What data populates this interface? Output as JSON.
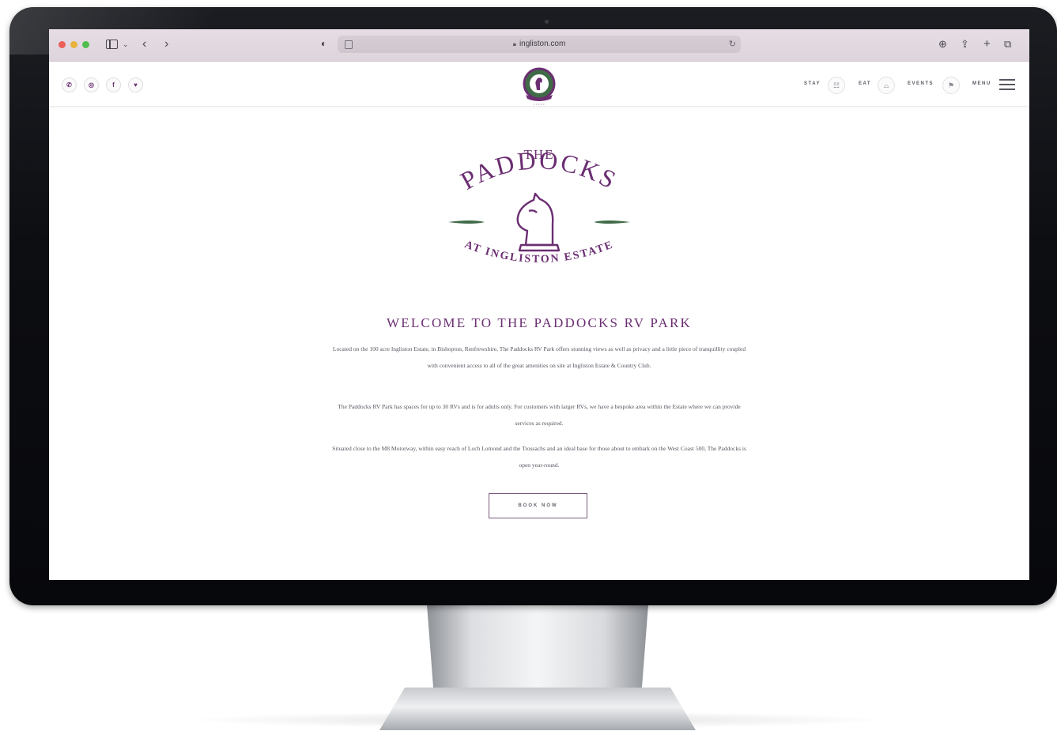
{
  "browser": {
    "url": "ingliston.com"
  },
  "header": {
    "nav": [
      {
        "label": "STAY",
        "icon": "bed-icon"
      },
      {
        "label": "EAT",
        "icon": "cloche-icon"
      },
      {
        "label": "EVENTS",
        "icon": "events-icon"
      },
      {
        "label": "MENU",
        "icon": "hamburger-icon"
      }
    ],
    "social_icons": [
      "phone-icon",
      "instagram-icon",
      "facebook-icon",
      "twitter-icon"
    ]
  },
  "logo": {
    "the": "THE",
    "name": "PADDOCKS",
    "subtitle": "AT INGLISTON ESTATE"
  },
  "main": {
    "title": "WELCOME TO THE PADDOCKS RV PARK",
    "paragraphs": [
      "Located on the 100 acre Ingliston Estate, in Bishopton, Renfrewshire, The Paddocks RV Park offers stunning views as well as privacy and a little piece of tranquillity coupled with convenient access to all of the great amenities on site at Ingliston Estate & Country Club.",
      "The Paddocks RV Park has spaces for up to 30 RVs and is for adults only. For customers with larger RVs, we have a bespoke area within the Estate where we can provide services as required.",
      "Situated close to the M8 Motorway, within easy reach of Loch Lomond and the Trossachs and an ideal base for those about to embark on the West Coast 500, The Paddocks is open year-round."
    ],
    "book_label": "BOOK NOW"
  },
  "colors": {
    "brand_purple": "#6b2e72",
    "accent_green": "#3f6b47"
  }
}
